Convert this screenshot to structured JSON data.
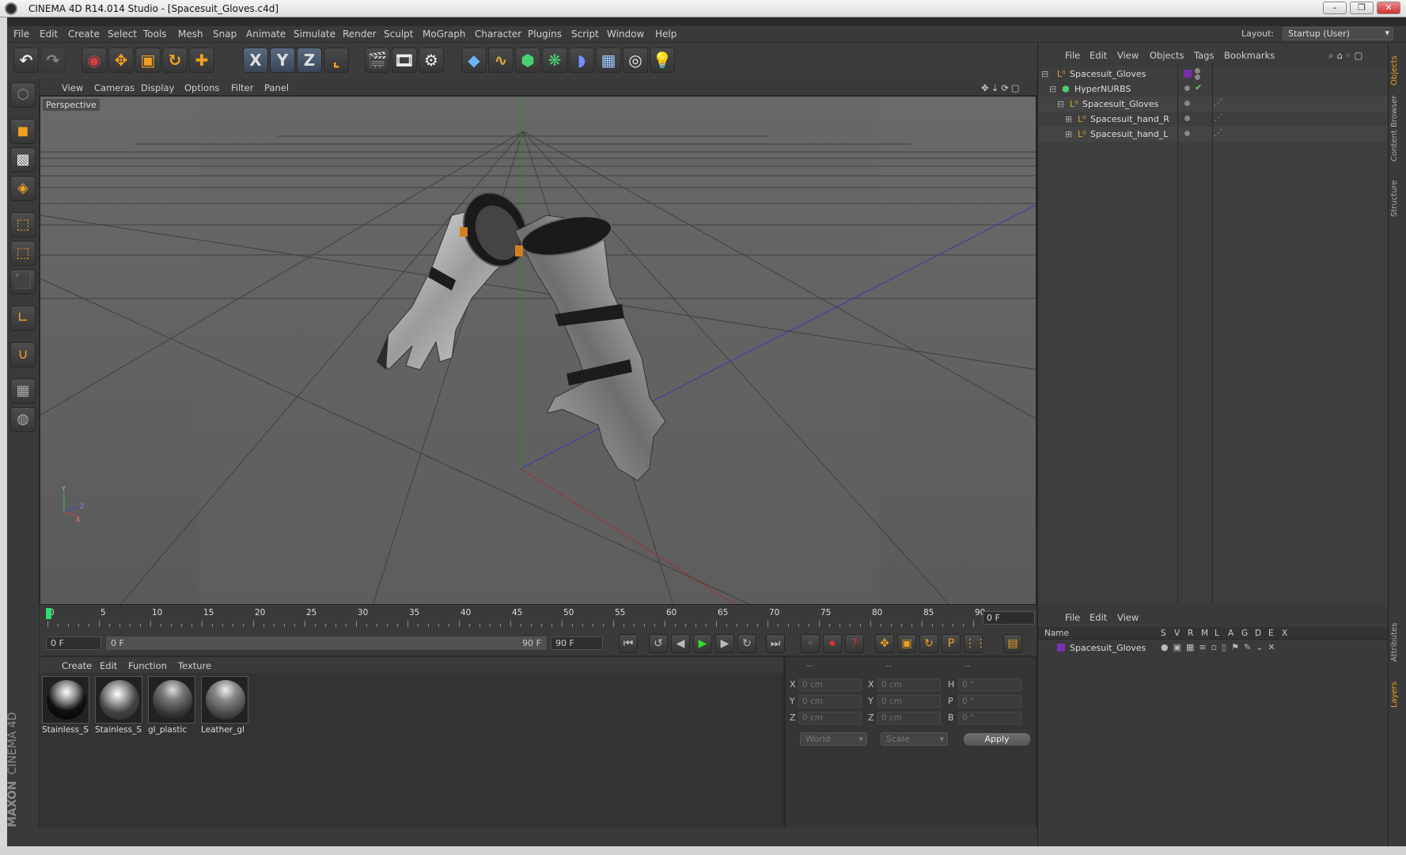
{
  "window": {
    "title": "CINEMA 4D R14.014 Studio - [Spacesuit_Gloves.c4d]",
    "buttons": [
      "–",
      "❐",
      "✕"
    ]
  },
  "menubar": {
    "items": [
      "File",
      "Edit",
      "Create",
      "Select",
      "Tools",
      "Mesh",
      "Snap",
      "Animate",
      "Simulate",
      "Render",
      "Sculpt",
      "MoGraph",
      "Character",
      "Plugins",
      "Script",
      "Window",
      "Help"
    ],
    "layout_label": "Layout:",
    "layout_value": "Startup (User)"
  },
  "toolbar": {
    "axis_labels": [
      "X",
      "Y",
      "Z"
    ]
  },
  "viewport": {
    "menu": [
      "View",
      "Cameras",
      "Display",
      "Options",
      "Filter",
      "Panel"
    ],
    "label": "Perspective",
    "axis_labels": [
      "Y",
      "Z",
      "X"
    ]
  },
  "timeline": {
    "ticks": [
      "0",
      "5",
      "10",
      "15",
      "20",
      "25",
      "30",
      "35",
      "40",
      "45",
      "50",
      "55",
      "60",
      "65",
      "70",
      "75",
      "80",
      "85",
      "90"
    ],
    "current_frame": "0 F"
  },
  "transport": {
    "start_frame": "0 F",
    "range_start": "0 F",
    "range_end": "90 F",
    "end_frame": "90 F"
  },
  "materials": {
    "menu": [
      "Create",
      "Edit",
      "Function",
      "Texture"
    ],
    "items": [
      {
        "name": "Stainless_S"
      },
      {
        "name": "Stainless_S"
      },
      {
        "name": "gl_plastic"
      },
      {
        "name": "Leather_gl"
      }
    ]
  },
  "coordinates": {
    "headers": [
      "--",
      "--",
      "--"
    ],
    "rows": [
      {
        "a": "X",
        "av": "0 cm",
        "b": "X",
        "bv": "0 cm",
        "c": "H",
        "cv": "0 °"
      },
      {
        "a": "Y",
        "av": "0 cm",
        "b": "Y",
        "bv": "0 cm",
        "c": "P",
        "cv": "0 °"
      },
      {
        "a": "Z",
        "av": "0 cm",
        "b": "Z",
        "bv": "0 cm",
        "c": "B",
        "cv": "0 °"
      }
    ],
    "mode_world": "World",
    "mode_scale": "Scale",
    "apply": "Apply"
  },
  "objects": {
    "menu": [
      "File",
      "Edit",
      "View",
      "Objects",
      "Tags",
      "Bookmarks"
    ],
    "tree": [
      {
        "name": "Spacesuit_Gloves"
      },
      {
        "name": "HyperNURBS"
      },
      {
        "name": "Spacesuit_Gloves"
      },
      {
        "name": "Spacesuit_hand_R"
      },
      {
        "name": "Spacesuit_hand_L"
      }
    ]
  },
  "layers": {
    "menu": [
      "File",
      "Edit",
      "View"
    ],
    "columns": [
      "Name",
      "S",
      "V",
      "R",
      "M",
      "L",
      "A",
      "G",
      "D",
      "E",
      "X"
    ],
    "row": "Spacesuit_Gloves"
  },
  "right_tabs": [
    "Objects",
    "Content Browser",
    "Structure",
    "Attributes",
    "Layers"
  ],
  "branding": {
    "vendor": "MAXON",
    "product": "CINEMA 4D"
  },
  "colors": {
    "accent": "#f0a020",
    "ui_bg": "#3a3a3a",
    "viewport_bg": "#5a5a5a",
    "layer_color": "#7a2fb0"
  }
}
